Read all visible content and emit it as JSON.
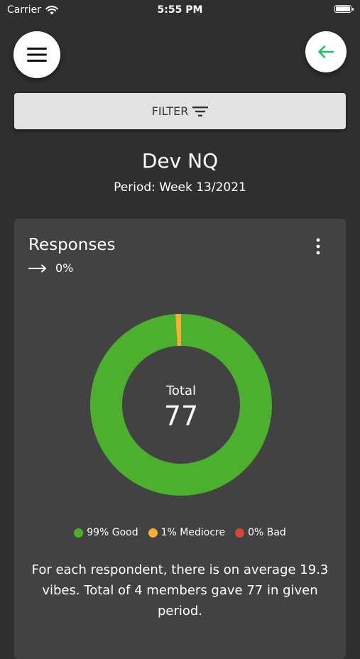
{
  "status_bar": {
    "carrier": "Carrier",
    "time": "5:55 PM"
  },
  "header": {
    "menu_icon": "hamburger-menu-icon",
    "back_icon": "arrow-left-icon",
    "back_color": "#1fbf6a"
  },
  "filter": {
    "label": "FILTER",
    "icon": "filter-lines-icon"
  },
  "team": {
    "name": "Dev NQ",
    "period": "Period: Week 13/2021"
  },
  "card": {
    "title": "Responses",
    "trend_icon": "arrow-right-icon",
    "trend_value": "0%",
    "center_label": "Total",
    "total": "77",
    "summary": "For each respondent, there is on average 19.3 vibes. Total of 4 members gave 77 in given period."
  },
  "legend": [
    {
      "label": "99% Good",
      "color": "#4caf2e"
    },
    {
      "label": "1% Mediocre",
      "color": "#f2b134"
    },
    {
      "label": "0% Bad",
      "color": "#d6453d"
    }
  ],
  "chart_data": {
    "type": "pie",
    "categories": [
      "Good",
      "Mediocre",
      "Bad"
    ],
    "values": [
      99,
      1,
      0
    ],
    "colors": [
      "#4caf2e",
      "#f2b134",
      "#d6453d"
    ]
  }
}
